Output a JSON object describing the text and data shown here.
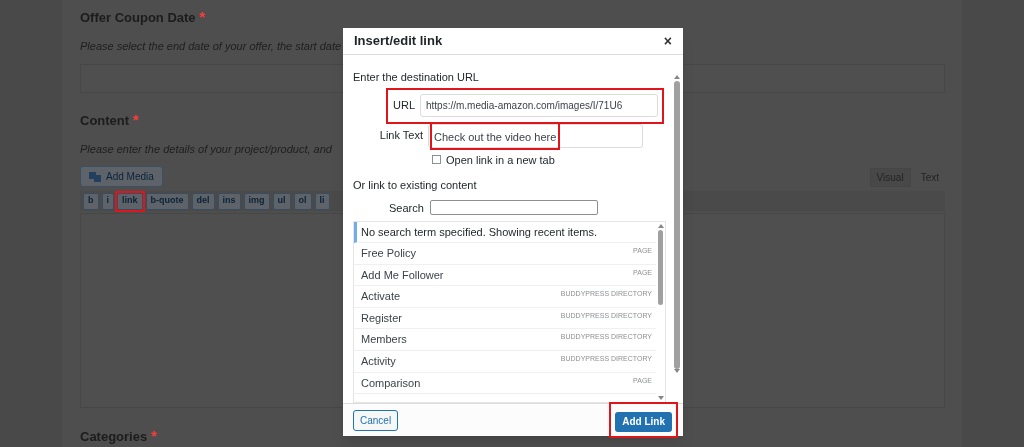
{
  "page": {
    "sections": [
      {
        "label": "Offer Coupon Date",
        "required_mark": "*",
        "hint": "Please select the end date of your offer, the start date"
      },
      {
        "label": "Content",
        "required_mark": "*",
        "hint": "Please enter the details of your project/product, and"
      }
    ],
    "add_media": "Add Media",
    "editor_tabs": [
      {
        "label": "Visual",
        "selected": true
      },
      {
        "label": "Text",
        "selected": false
      }
    ],
    "toolbar": [
      {
        "label": "b",
        "highlighted": false
      },
      {
        "label": "i",
        "highlighted": false
      },
      {
        "label": "link",
        "highlighted": true
      },
      {
        "label": "b-quote",
        "highlighted": false
      },
      {
        "label": "del",
        "highlighted": false
      },
      {
        "label": "ins",
        "highlighted": false
      },
      {
        "label": "img",
        "highlighted": false
      },
      {
        "label": "ul",
        "highlighted": false
      },
      {
        "label": "ol",
        "highlighted": false
      },
      {
        "label": "li",
        "highlighted": false
      }
    ],
    "next_section": {
      "label": "Categories",
      "required_mark": "*"
    }
  },
  "dialog": {
    "title": "Insert/edit link",
    "close": "×",
    "intro": "Enter the destination URL",
    "url": {
      "label": "URL",
      "value": "https://m.media-amazon.com/images/I/71U6",
      "highlighted": true
    },
    "link_text": {
      "label": "Link Text",
      "value": "Check out the video here",
      "highlighted": true
    },
    "new_tab": {
      "label": "Open link in a new tab",
      "checked": false
    },
    "existing_heading": "Or link to existing content",
    "search": {
      "label": "Search"
    },
    "notice": "No search term specified. Showing recent items.",
    "results": [
      {
        "title": "Free Policy",
        "type": "PAGE"
      },
      {
        "title": "Add Me Follower",
        "type": "PAGE"
      },
      {
        "title": "Activate",
        "type": "BUDDYPRESS DIRECTORY"
      },
      {
        "title": "Register",
        "type": "BUDDYPRESS DIRECTORY"
      },
      {
        "title": "Members",
        "type": "BUDDYPRESS DIRECTORY"
      },
      {
        "title": "Activity",
        "type": "BUDDYPRESS DIRECTORY"
      },
      {
        "title": "Comparison",
        "type": "PAGE"
      }
    ],
    "cancel": "Cancel",
    "add": {
      "label": "Add Link",
      "highlighted": true
    }
  }
}
